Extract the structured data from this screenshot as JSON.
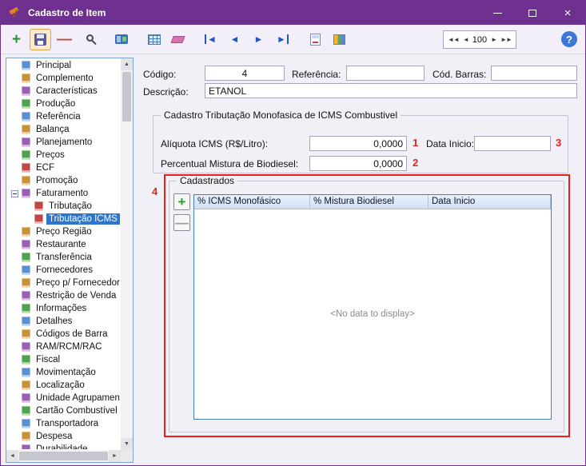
{
  "window": {
    "title": "Cadastro de Item"
  },
  "toolbar": {
    "counter_value": "100"
  },
  "sidebar": {
    "items": [
      {
        "label": "Principal",
        "level": 0
      },
      {
        "label": "Complemento",
        "level": 0
      },
      {
        "label": "Características",
        "level": 0
      },
      {
        "label": "Produção",
        "level": 0
      },
      {
        "label": "Referência",
        "level": 0
      },
      {
        "label": "Balança",
        "level": 0
      },
      {
        "label": "Planejamento",
        "level": 0
      },
      {
        "label": "Preços",
        "level": 0
      },
      {
        "label": "ECF",
        "level": 0
      },
      {
        "label": "Promoção",
        "level": 0
      },
      {
        "label": "Faturamento",
        "level": 0,
        "expanded": true
      },
      {
        "label": "Tributação",
        "level": 1
      },
      {
        "label": "Tributação ICMS M",
        "level": 1,
        "selected": true
      },
      {
        "label": "Preço Região",
        "level": 0
      },
      {
        "label": "Restaurante",
        "level": 0
      },
      {
        "label": "Transferência",
        "level": 0
      },
      {
        "label": "Fornecedores",
        "level": 0
      },
      {
        "label": "Preço p/ Fornecedor",
        "level": 0
      },
      {
        "label": "Restrição de Venda",
        "level": 0
      },
      {
        "label": "Informações",
        "level": 0
      },
      {
        "label": "Detalhes",
        "level": 0
      },
      {
        "label": "Códigos de Barra",
        "level": 0
      },
      {
        "label": "RAM/RCM/RAC",
        "level": 0
      },
      {
        "label": "Fiscal",
        "level": 0
      },
      {
        "label": "Movimentação",
        "level": 0
      },
      {
        "label": "Localização",
        "level": 0
      },
      {
        "label": "Unidade Agrupamento",
        "level": 0
      },
      {
        "label": "Cartão Combustível",
        "level": 0
      },
      {
        "label": "Transportadora",
        "level": 0
      },
      {
        "label": "Despesa",
        "level": 0
      },
      {
        "label": "Durabilidade",
        "level": 0
      }
    ]
  },
  "form": {
    "codigo_label": "Código:",
    "codigo_value": "4",
    "referencia_label": "Referência:",
    "referencia_value": "",
    "cod_barras_label": "Cód. Barras:",
    "cod_barras_value": "",
    "descricao_label": "Descrição:",
    "descricao_value": "ETANOL"
  },
  "tributacao_group": {
    "title": "Cadastro Tributação Monofasica de ICMS Combustivel",
    "aliquota_label": "Alíquota ICMS (R$/Litro):",
    "aliquota_value": "0,0000",
    "percentual_label": "Percentual Mistura de Biodiesel:",
    "percentual_value": "0,0000",
    "data_inicio_label": "Data Inicio:",
    "data_inicio_value": ""
  },
  "cadastrados": {
    "title": "Cadastrados",
    "columns": [
      "% ICMS Monofásico",
      "% Mistura Biodiesel",
      "Data Inicio"
    ],
    "empty_text": "<No data to display>"
  },
  "annotations": {
    "n1": "1",
    "n2": "2",
    "n3": "3",
    "n4": "4"
  },
  "colors": {
    "titlebar": "#6E3190",
    "selection": "#2E75CC",
    "annotation_red": "#E8201A",
    "grid_header_bg": "#D8E6F5"
  }
}
